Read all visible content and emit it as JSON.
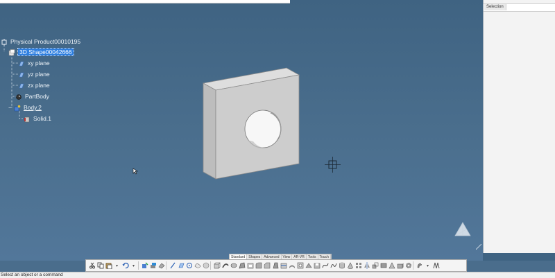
{
  "tree": {
    "root": "Physical Product00010195",
    "shape": "3D Shape00042666",
    "planes": [
      "xy plane",
      "yz plane",
      "zx plane"
    ],
    "part_body": "PartBody",
    "body2": "Body.2",
    "solid": "Solid.1"
  },
  "right_panel": {
    "tab": "Selection"
  },
  "action_tabs": [
    "Standard",
    "Shapes",
    "Advanced",
    "View",
    "AR-VR",
    "Tools",
    "Touch"
  ],
  "status": "Select an object or a command",
  "colors": {
    "viewport": "#44688a",
    "selection": "#2e7fe0",
    "part_face": "#cfcfcf"
  }
}
